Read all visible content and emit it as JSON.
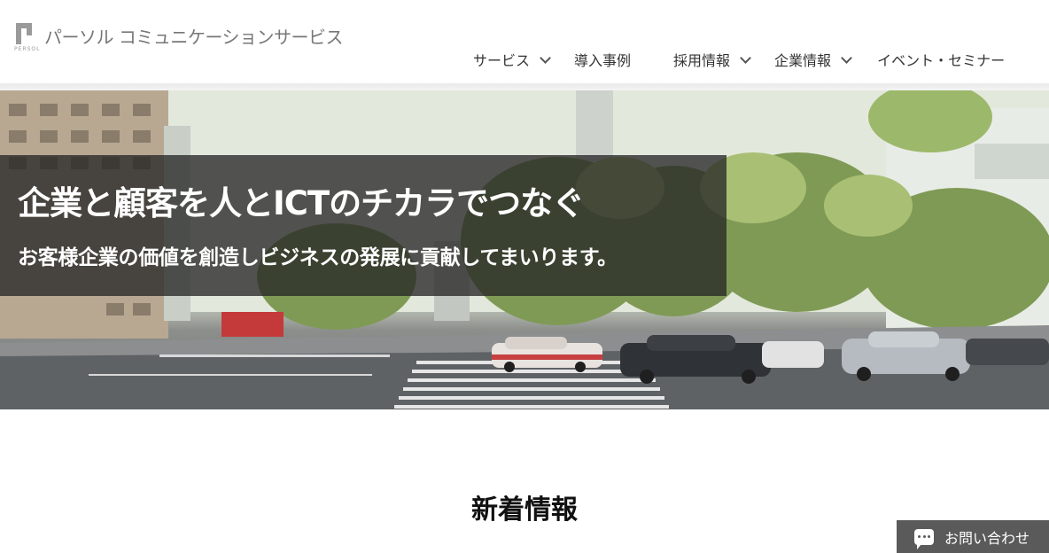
{
  "header": {
    "logo_sub": "PERSOL",
    "logo_text": "パーソル コミュニケーションサービス"
  },
  "nav": {
    "items": [
      {
        "label": "サービス",
        "has_dropdown": true
      },
      {
        "label": "導入事例",
        "has_dropdown": false
      },
      {
        "label": "採用情報",
        "has_dropdown": true
      },
      {
        "label": "企業情報",
        "has_dropdown": true
      },
      {
        "label": "イベント・セミナー",
        "has_dropdown": false
      }
    ]
  },
  "hero": {
    "title": "企業と顧客を人とICTのチカラでつなぐ",
    "subtitle": "お客様企業の価値を創造しビジネスの発展に貢献してまいります。"
  },
  "news": {
    "title": "新着情報"
  },
  "contact": {
    "label": "お問い合わせ",
    "icon": "chat-bubble-icon"
  }
}
